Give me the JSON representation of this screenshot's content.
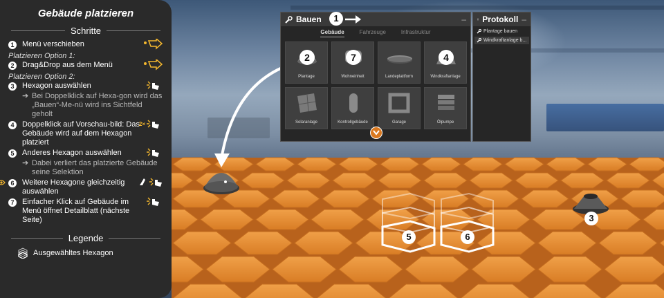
{
  "panel": {
    "title": "Gebäude platzieren",
    "steps_heading": "Schritte",
    "option1": "Platzieren Option 1:",
    "option2": "Platzieren Option 2:",
    "steps": [
      {
        "num": "1",
        "text": "Menü verschieben"
      },
      {
        "num": "2",
        "text": "Drag&Drop aus dem Menü"
      },
      {
        "num": "3",
        "text": "Hexagon auswählen"
      },
      {
        "num": "4",
        "text": "Doppelklick auf Vorschau-bild: Das Gebäude wird auf dem Hexagon platziert"
      },
      {
        "num": "5",
        "text": "Anderes Hexagon auswählen"
      },
      {
        "num": "6",
        "text": "Weitere Hexagone gleichzeitig auswählen"
      },
      {
        "num": "7",
        "text": "Einfacher Klick auf Gebäude im Menü öffnet Detailblatt (nächste Seite)"
      }
    ],
    "sub3": "Bei Doppelklick auf Hexa-gon wird das „Bauen“-Me-nü wird ins Sichtfeld geholt",
    "sub5": "Dabei verliert das platzierte Gebäude seine Selektion",
    "double_click_label": "2×",
    "legend_heading": "Legende",
    "legend_item": "Ausgewähltes Hexagon"
  },
  "bauen": {
    "title": "Bauen",
    "minimize": "–",
    "badge": "1",
    "tabs": [
      "Gebäude",
      "Fahrzeuge",
      "Infrastruktur"
    ],
    "tiles": [
      {
        "label": "Plantage",
        "badge": "2",
        "icon": "dome"
      },
      {
        "label": "Wohneinheit",
        "badge": "7",
        "icon": "house"
      },
      {
        "label": "Landeplattform",
        "badge": "",
        "icon": "platform"
      },
      {
        "label": "Windkraftanlage",
        "badge": "4",
        "icon": "cone"
      },
      {
        "label": "Solaranlage",
        "badge": "",
        "icon": "panel"
      },
      {
        "label": "Kontrollgebäude",
        "badge": "",
        "icon": "tower"
      },
      {
        "label": "Garage",
        "badge": "",
        "icon": "frame"
      },
      {
        "label": "Ölpumpe",
        "badge": "",
        "icon": "stack"
      }
    ]
  },
  "protokoll": {
    "title": "Protokoll",
    "minimize": "–",
    "items": [
      {
        "text": "Plantage bauen",
        "selected": false
      },
      {
        "text": "Windkraftanlage b...",
        "selected": true
      }
    ]
  },
  "scene": {
    "badges": [
      "3",
      "5",
      "6"
    ],
    "hex_color": "#e8913a",
    "panel_color": "#2a2a2a",
    "accent": "#d9781f"
  }
}
